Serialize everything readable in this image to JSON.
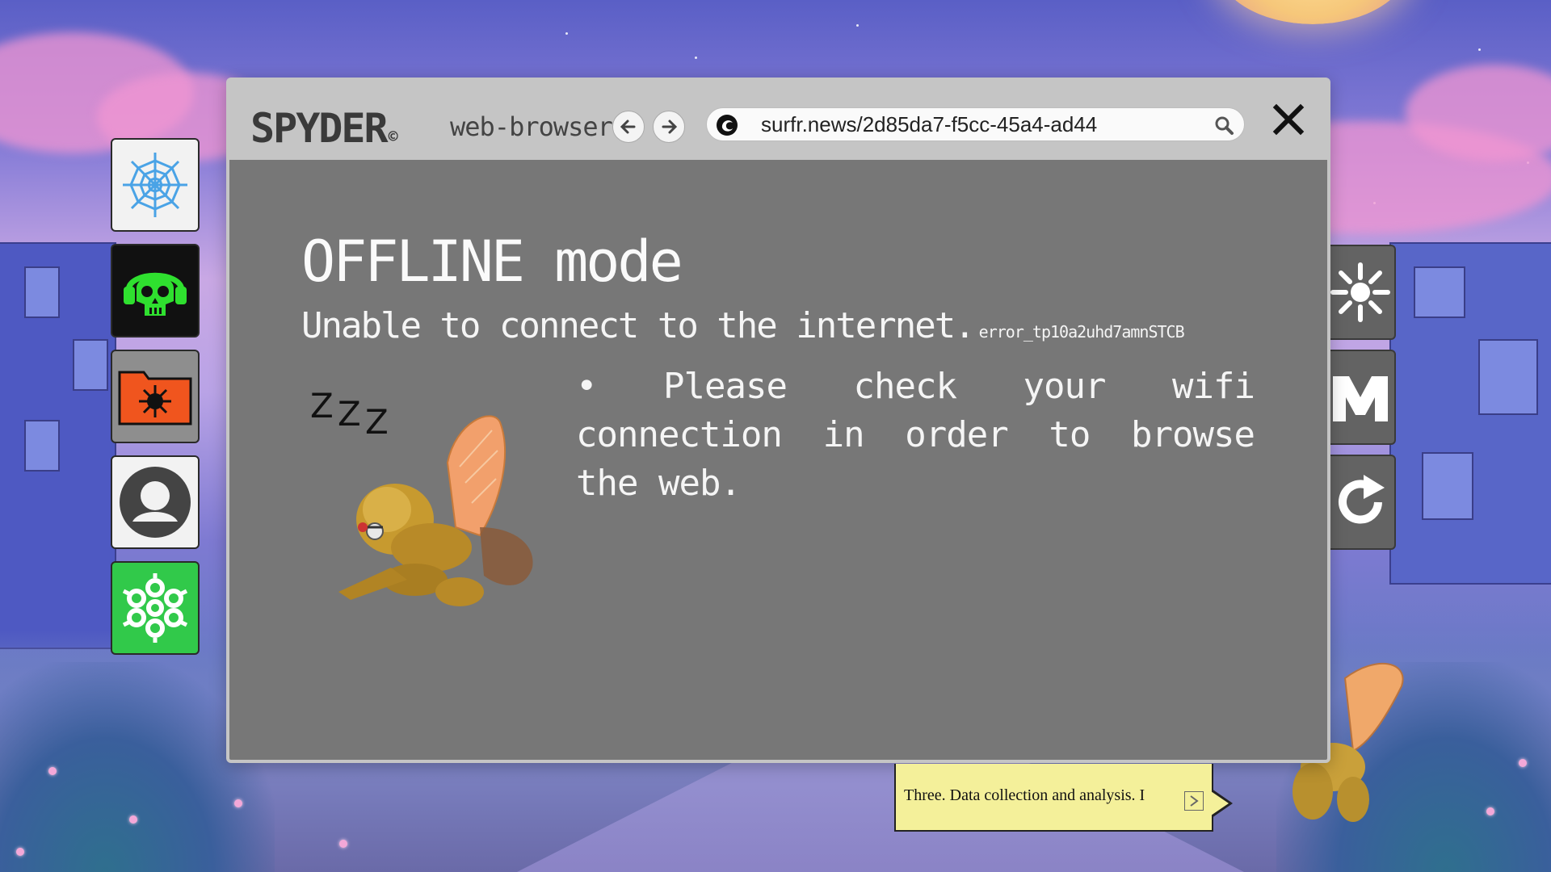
{
  "browser": {
    "logo": "SPYDER",
    "logo_mark": "©",
    "subtitle": "web-browser",
    "url": "surfr.news/2d85da7-f5cc-45a4-ad44",
    "back_icon": "arrow-left-icon",
    "forward_icon": "arrow-right-icon",
    "close_icon": "close-icon"
  },
  "error_page": {
    "title": "OFFLINE mode",
    "message": "Unable to connect to the internet.",
    "error_code": "error_tp10a2uhd7amnSTCB",
    "bullet": "• Please check your wifi connection in order to browse the web.",
    "zzz": [
      "Z",
      "Z",
      "Z"
    ]
  },
  "left_dock": [
    {
      "icon": "spiderweb-icon"
    },
    {
      "icon": "skull-headphones-icon"
    },
    {
      "icon": "virus-folder-icon"
    },
    {
      "icon": "user-profile-icon"
    },
    {
      "icon": "network-flower-icon"
    }
  ],
  "right_dock": [
    {
      "icon": "burst-icon"
    },
    {
      "icon": "m-logo-icon"
    },
    {
      "icon": "refresh-icon"
    }
  ],
  "speech_bubble": {
    "text": "Three. Data collection and analysis. I",
    "next_icon": "next-arrow-icon"
  },
  "colors": {
    "window_bg": "#777777",
    "titlebar_bg": "#c5c5c5",
    "bubble_bg": "#f4f09a",
    "dock_green": "#31c94a"
  }
}
